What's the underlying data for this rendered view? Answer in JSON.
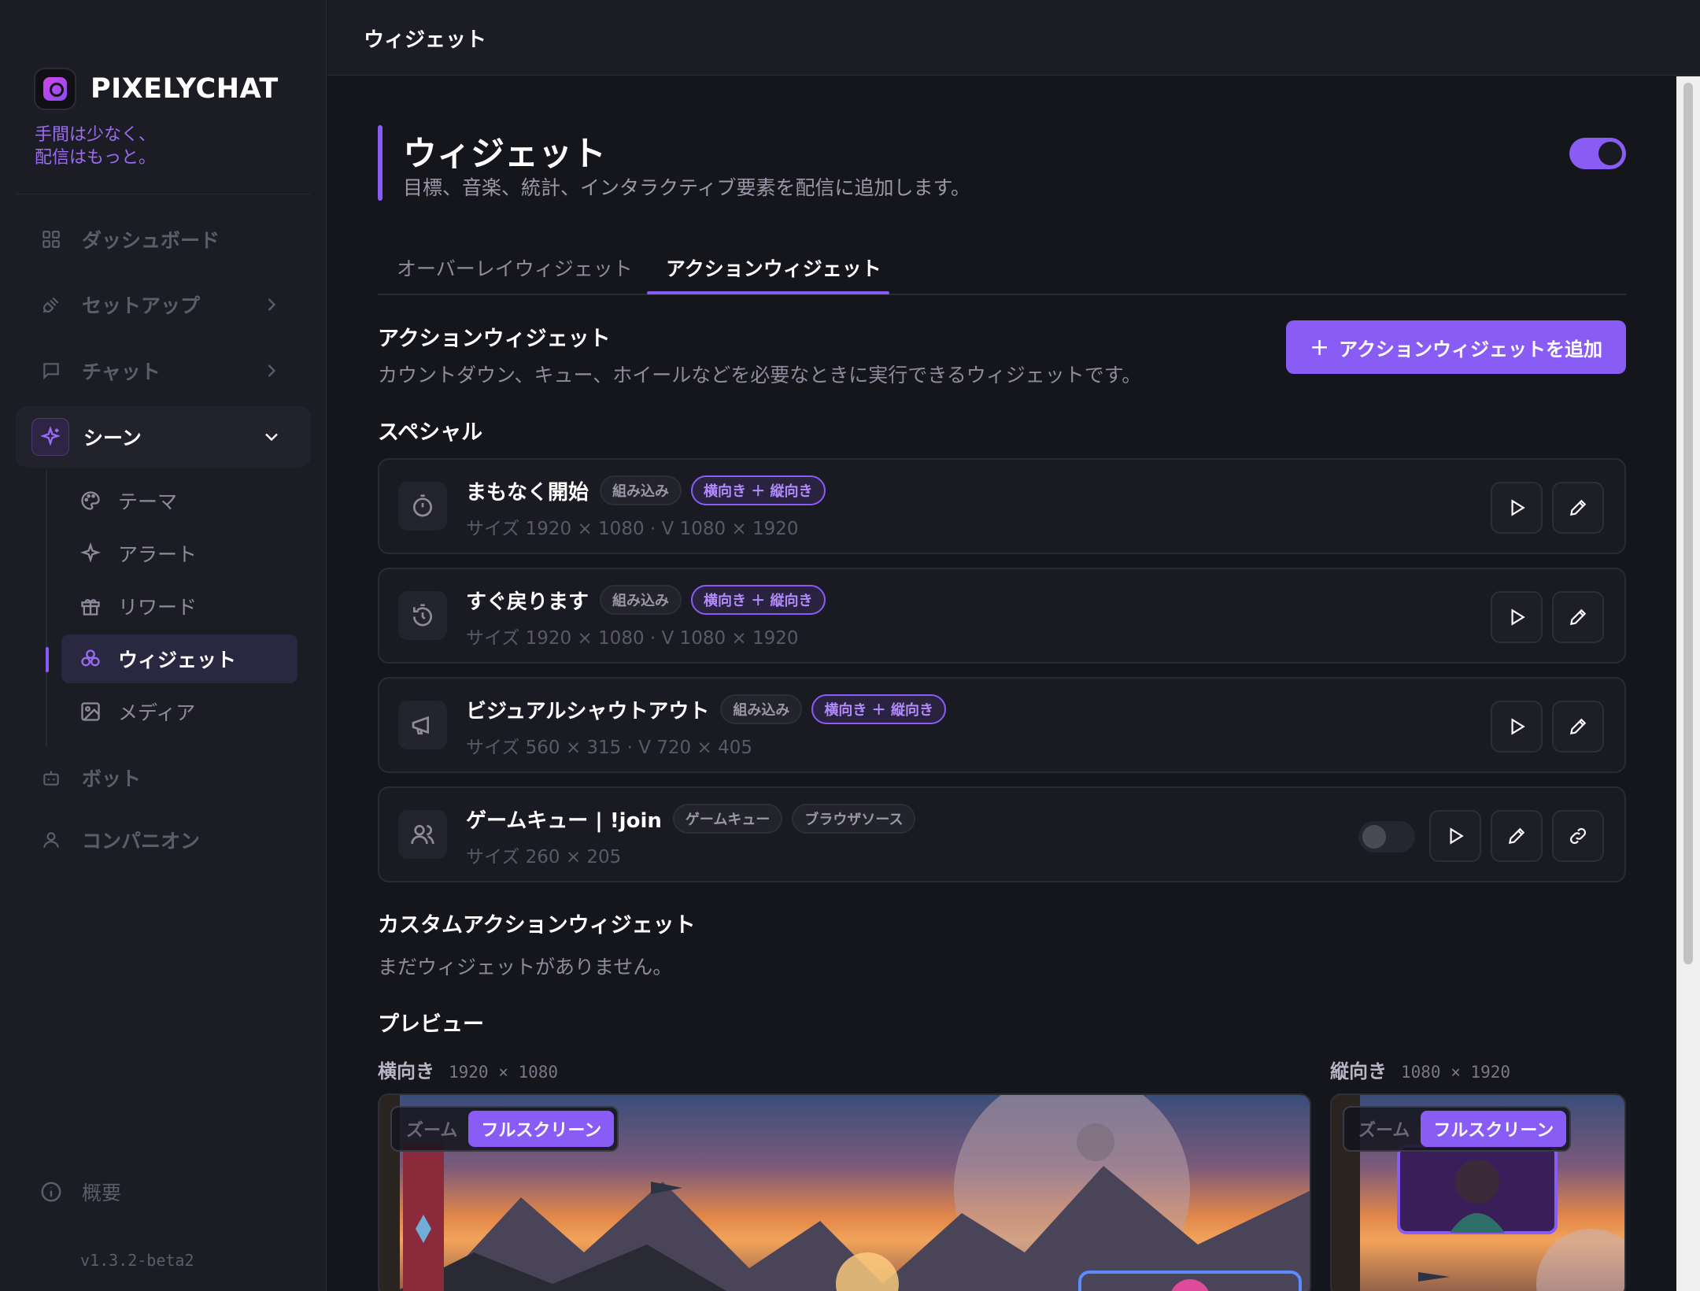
{
  "brand": {
    "name": "PIXELYCHAT",
    "tagline_1": "手間は少なく、",
    "tagline_2": "配信はもっと。"
  },
  "sidebar": {
    "items": [
      {
        "label": "ダッシュボード",
        "icon": "grid-icon"
      },
      {
        "label": "セットアップ",
        "icon": "plug-icon"
      },
      {
        "label": "チャット",
        "icon": "chat-bubble-icon"
      },
      {
        "label": "シーン",
        "icon": "sparkle-icon"
      }
    ],
    "sub_items": [
      {
        "label": "テーマ",
        "icon": "palette-icon"
      },
      {
        "label": "アラート",
        "icon": "sparkle-icon"
      },
      {
        "label": "リワード",
        "icon": "gift-icon"
      },
      {
        "label": "ウィジェット",
        "icon": "widgets-icon"
      },
      {
        "label": "メディア",
        "icon": "image-icon"
      }
    ],
    "bottom_items": [
      {
        "label": "ボット",
        "icon": "robot-icon"
      },
      {
        "label": "コンパニオン",
        "icon": "person-icon"
      }
    ],
    "about": "概要",
    "version": "v1.3.2-beta2"
  },
  "topbar": {
    "title": "ウィジェット"
  },
  "page": {
    "title": "ウィジェット",
    "subtitle": "目標、音楽、統計、インタラクティブ要素を配信に追加します。",
    "enabled": true
  },
  "tabs": [
    {
      "label": "オーバーレイウィジェット",
      "active": false
    },
    {
      "label": "アクションウィジェット",
      "active": true
    }
  ],
  "action_section": {
    "title": "アクションウィジェット",
    "description": "カウントダウン、キュー、ホイールなどを必要なときに実行できるウィジェットです。",
    "add_button": "アクションウィジェットを追加"
  },
  "special": {
    "title": "スペシャル",
    "widgets": [
      {
        "name": "まもなく開始",
        "icon": "timer-icon",
        "badges": [
          "組み込み",
          "横向き ＋ 縦向き"
        ],
        "size": "サイズ 1920 × 1080 · V 1080 × 1920"
      },
      {
        "name": "すぐ戻ります",
        "icon": "timer-reset-icon",
        "badges": [
          "組み込み",
          "横向き ＋ 縦向き"
        ],
        "size": "サイズ 1920 × 1080 · V 1080 × 1920"
      },
      {
        "name": "ビジュアルシャウトアウト",
        "icon": "megaphone-icon",
        "badges": [
          "組み込み",
          "横向き ＋ 縦向き"
        ],
        "size": "サイズ 560 × 315 · V 720 × 405"
      },
      {
        "name": "ゲームキュー | !join",
        "icon": "users-icon",
        "badges": [
          "ゲームキュー",
          "ブラウザソース"
        ],
        "size": "サイズ 260 × 205",
        "toggle_on": false
      }
    ]
  },
  "custom": {
    "title": "カスタムアクションウィジェット",
    "empty": "まだウィジェットがありません。"
  },
  "preview": {
    "title": "プレビュー",
    "landscape_label": "横向き",
    "landscape_dims": "1920 × 1080",
    "portrait_label": "縦向き",
    "portrait_dims": "1080 × 1920",
    "zoom_label": "ズーム",
    "fullscreen_label": "フルスクリーン"
  },
  "colors": {
    "accent": "#8a5cf6",
    "background": "#15151c",
    "sidebar": "#1c1c25"
  }
}
